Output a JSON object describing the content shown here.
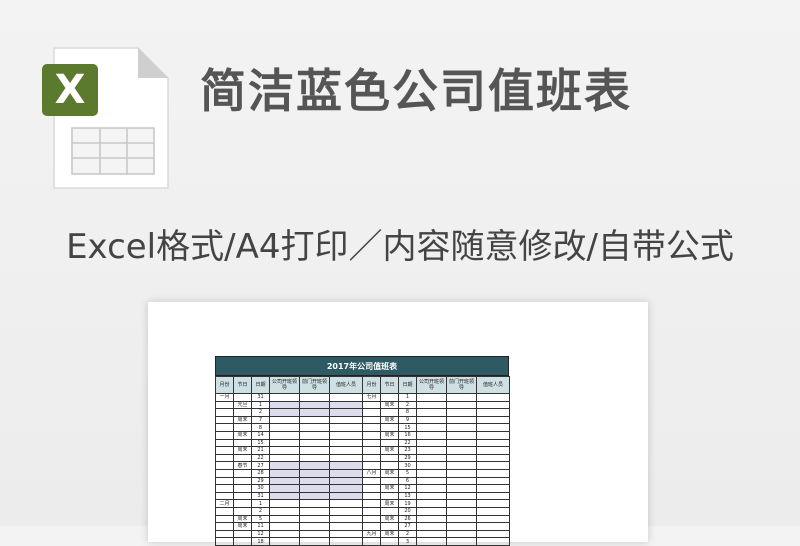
{
  "headline": "简洁蓝色公司值班表",
  "subline": "Excel格式/A4打印／内容随意修改/自带公式",
  "icon": {
    "name": "excel-file-icon",
    "badge_letter": "X",
    "badge_color": "#5c7a2e"
  },
  "sheet": {
    "title": "2017年公司值班表",
    "header_color": "#2e5b63",
    "columns": [
      "月份",
      "节日",
      "日期",
      "公司开班领导",
      "前门开班领导",
      "值班人员",
      "月份",
      "节日",
      "日期",
      "公司开班领导",
      "前门开班领导",
      "值班人员"
    ],
    "left_rows": [
      {
        "month": "一月",
        "note": "",
        "date": "31"
      },
      {
        "month": "",
        "note": "元旦",
        "date": "1"
      },
      {
        "month": "",
        "note": "",
        "date": "2"
      },
      {
        "month": "",
        "note": "周末",
        "date": "7"
      },
      {
        "month": "",
        "note": "",
        "date": "8"
      },
      {
        "month": "",
        "note": "周末",
        "date": "14"
      },
      {
        "month": "",
        "note": "",
        "date": "15"
      },
      {
        "month": "",
        "note": "周末",
        "date": "21"
      },
      {
        "month": "",
        "note": "",
        "date": "22"
      },
      {
        "month": "",
        "note": "春节",
        "date": "27"
      },
      {
        "month": "",
        "note": "",
        "date": "28"
      },
      {
        "month": "",
        "note": "",
        "date": "29"
      },
      {
        "month": "",
        "note": "",
        "date": "30"
      },
      {
        "month": "",
        "note": "",
        "date": "31"
      },
      {
        "month": "二月",
        "note": "",
        "date": "1"
      },
      {
        "month": "",
        "note": "",
        "date": "2"
      },
      {
        "month": "",
        "note": "周末",
        "date": "5"
      },
      {
        "month": "",
        "note": "周末",
        "date": "11"
      },
      {
        "month": "",
        "note": "",
        "date": "12"
      },
      {
        "month": "",
        "note": "",
        "date": "18"
      }
    ],
    "right_rows": [
      {
        "month": "七月",
        "note": "",
        "date": "1"
      },
      {
        "month": "",
        "note": "周末",
        "date": "2"
      },
      {
        "month": "",
        "note": "",
        "date": "8"
      },
      {
        "month": "",
        "note": "周末",
        "date": "9"
      },
      {
        "month": "",
        "note": "",
        "date": "15"
      },
      {
        "month": "",
        "note": "周末",
        "date": "16"
      },
      {
        "month": "",
        "note": "",
        "date": "22"
      },
      {
        "month": "",
        "note": "周末",
        "date": "23"
      },
      {
        "month": "",
        "note": "",
        "date": "29"
      },
      {
        "month": "",
        "note": "",
        "date": "30"
      },
      {
        "month": "八月",
        "note": "周末",
        "date": "5"
      },
      {
        "month": "",
        "note": "",
        "date": "6"
      },
      {
        "month": "",
        "note": "周末",
        "date": "12"
      },
      {
        "month": "",
        "note": "",
        "date": "13"
      },
      {
        "month": "",
        "note": "周末",
        "date": "19"
      },
      {
        "month": "",
        "note": "",
        "date": "20"
      },
      {
        "month": "",
        "note": "周末",
        "date": "26"
      },
      {
        "month": "",
        "note": "",
        "date": "27"
      },
      {
        "month": "九月",
        "note": "周末",
        "date": "2"
      },
      {
        "month": "",
        "note": "",
        "date": "3"
      }
    ]
  }
}
